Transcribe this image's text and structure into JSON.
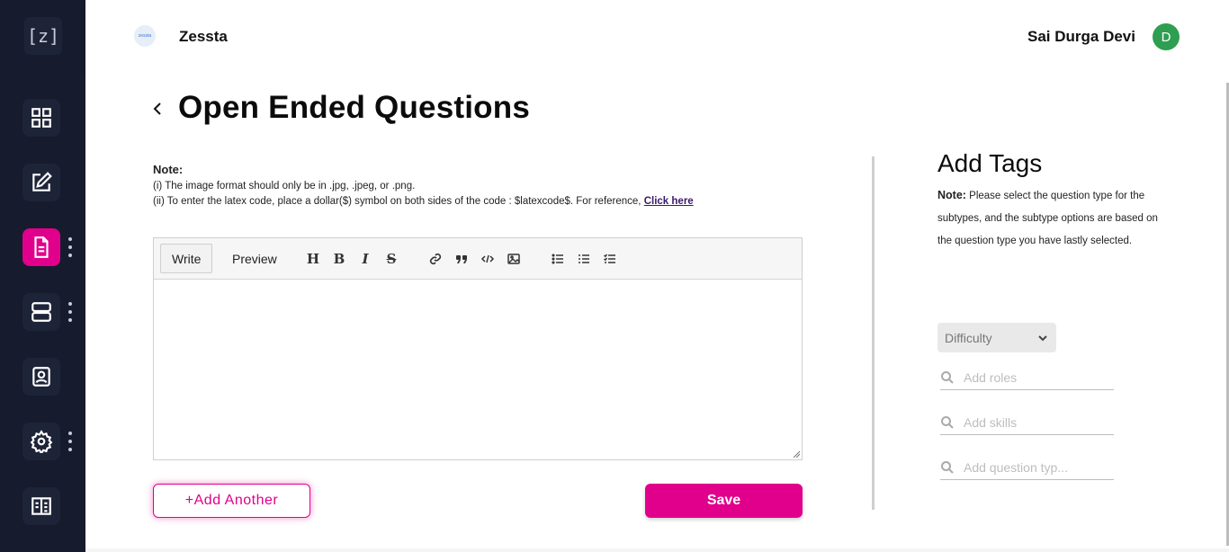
{
  "sidebar": {
    "logo_text": "[z]",
    "items": [
      {
        "name": "dashboard",
        "icon": "grid-icon"
      },
      {
        "name": "edit",
        "icon": "edit-icon"
      },
      {
        "name": "questions",
        "icon": "document-icon",
        "active": true
      },
      {
        "name": "servers",
        "icon": "server-icon"
      },
      {
        "name": "profile",
        "icon": "id-card-icon"
      },
      {
        "name": "settings",
        "icon": "settings-icon"
      },
      {
        "name": "reports",
        "icon": "building-icon"
      }
    ],
    "accent_color": "#e1008c",
    "background": "#161b2e"
  },
  "header": {
    "brand_logo_text": "zessta",
    "brand_name": "Zessta",
    "user_name": "Sai Durga Devi",
    "avatar_initial": "D",
    "avatar_color": "#2e9e50"
  },
  "page": {
    "title": "Open Ended Questions",
    "note_title": "Note:",
    "note_line1": "(i) The image format should only be in .jpg, .jpeg, or .png.",
    "note_line2": "(ii) To enter the latex code, place a dollar($) symbol on both sides of the code : $latexcode$. For reference,",
    "note_link": "Click here"
  },
  "editor": {
    "tabs": {
      "write": "Write",
      "preview": "Preview"
    },
    "toolbar": {
      "heading": "H",
      "bold": "B",
      "italic": "I",
      "strikethrough": "S",
      "icons": [
        "heading-icon",
        "bold-icon",
        "italic-icon",
        "strikethrough-icon",
        "link-icon",
        "quote-icon",
        "code-icon",
        "image-icon",
        "bulleted-list-icon",
        "numbered-list-icon",
        "task-list-icon"
      ]
    },
    "content": ""
  },
  "actions": {
    "add_another": "+Add Another",
    "save": "Save"
  },
  "tags": {
    "title": "Add Tags",
    "note_label": "Note:",
    "note_text": "Please select the question type for the subtypes, and the subtype options are based on the question type you have lastly selected.",
    "difficulty": "Difficulty",
    "roles_placeholder": "Add roles",
    "skills_placeholder": "Add skills",
    "question_type_placeholder": "Add question typ..."
  }
}
